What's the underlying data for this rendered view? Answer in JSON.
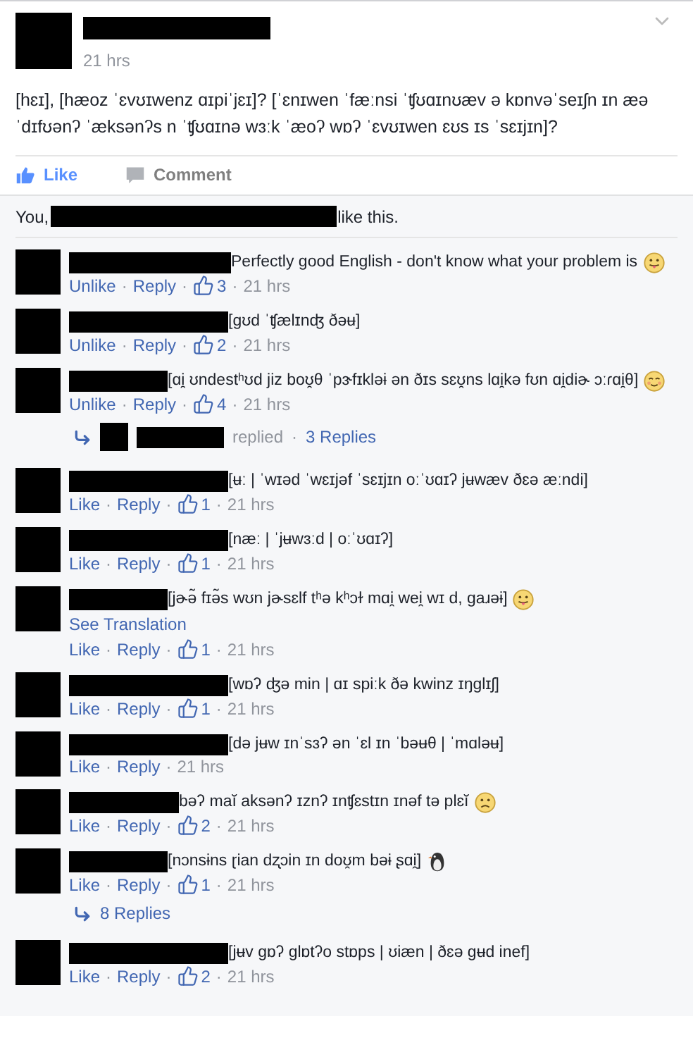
{
  "post": {
    "time": "21 hrs",
    "text": "[hɛɪ], [hæoz ˈɛvʊɪwenz ɑɪpiˈjɛɪ]? [ˈɛnɪwen ˈfæːnsi ˈʧʊɑɪnʊæv ə kɒnvəˈseɪʃn ɪn æə ˈdɪfʊənʔ ˈæksənʔs n ˈʧʊɑɪnə wɜːk ˈæoʔ wɒʔ ˈɛvʊɪwen ɛʊs ɪs ˈsɛɪjɪn]?"
  },
  "actions": [
    {
      "kind": "like",
      "label": "Like",
      "selected": true
    },
    {
      "kind": "comment",
      "label": "Comment",
      "selected": false
    }
  ],
  "likes_line": {
    "prefix": "You,",
    "suffix": "like this."
  },
  "comments": [
    {
      "text": "Perfectly good English - don't know what your problem is",
      "emoji": {
        "kind": "tongue"
      },
      "meta": [
        {
          "kind": "like",
          "text": "Unlike"
        },
        {
          "kind": "dot",
          "text": "·"
        },
        {
          "kind": "reply",
          "text": "Reply"
        },
        {
          "kind": "dot",
          "text": "·"
        },
        {
          "kind": "count",
          "text": "3"
        },
        {
          "kind": "dot",
          "text": "·"
        },
        {
          "kind": "time",
          "text": "21 hrs"
        }
      ]
    },
    {
      "text": "[gʊd ˈʧælɪnʤ ðəʉ]",
      "meta": [
        {
          "kind": "like",
          "text": "Unlike"
        },
        {
          "kind": "dot",
          "text": "·"
        },
        {
          "kind": "reply",
          "text": "Reply"
        },
        {
          "kind": "dot",
          "text": "·"
        },
        {
          "kind": "count",
          "text": "2"
        },
        {
          "kind": "dot",
          "text": "·"
        },
        {
          "kind": "time",
          "text": "21 hrs"
        }
      ]
    },
    {
      "text": "[ɑi̯ ʊndestʰʊd jiz boʊ̯θ ˈpɝfɪkləɨ ən ðɪs sɛʊ̯ns lɑi̯kə fʊn ɑi̯diɚ ɔːɾɑi̯θ]",
      "emoji": {
        "kind": "blush"
      },
      "meta": [
        {
          "kind": "like",
          "text": "Unlike"
        },
        {
          "kind": "dot",
          "text": "·"
        },
        {
          "kind": "reply",
          "text": "Reply"
        },
        {
          "kind": "dot",
          "text": "·"
        },
        {
          "kind": "count",
          "text": "4"
        },
        {
          "kind": "dot",
          "text": "·"
        },
        {
          "kind": "time",
          "text": "21 hrs"
        }
      ],
      "replies": {
        "summary": "replied",
        "sep": "·",
        "link": "3 Replies"
      }
    },
    {
      "text": "[ʉː | ˈwɪəd ˈwɛɪjəf ˈsɛɪjɪn oːˈʊɑɪʔ jʉwæv ðɛə æːndi]",
      "meta": [
        {
          "kind": "like",
          "text": "Like"
        },
        {
          "kind": "dot",
          "text": "·"
        },
        {
          "kind": "reply",
          "text": "Reply"
        },
        {
          "kind": "dot",
          "text": "·"
        },
        {
          "kind": "count",
          "text": "1"
        },
        {
          "kind": "dot",
          "text": "·"
        },
        {
          "kind": "time",
          "text": "21 hrs"
        }
      ]
    },
    {
      "text": "[næː | ˈjʉwɜːd | oːˈʊɑɪʔ]",
      "meta": [
        {
          "kind": "like",
          "text": "Like"
        },
        {
          "kind": "dot",
          "text": "·"
        },
        {
          "kind": "reply",
          "text": "Reply"
        },
        {
          "kind": "dot",
          "text": "·"
        },
        {
          "kind": "count",
          "text": "1"
        },
        {
          "kind": "dot",
          "text": "·"
        },
        {
          "kind": "time",
          "text": "21 hrs"
        }
      ]
    },
    {
      "text": "[jɚə̃ fɪə̃s wʊn jɚsɛlf tʰə kʰɔɫ mɑi̯ wei̯ wɪ d, gaɹəɨ]",
      "emoji": {
        "kind": "tongue"
      },
      "translation": "See Translation",
      "meta": [
        {
          "kind": "like",
          "text": "Like"
        },
        {
          "kind": "dot",
          "text": "·"
        },
        {
          "kind": "reply",
          "text": "Reply"
        },
        {
          "kind": "dot",
          "text": "·"
        },
        {
          "kind": "count",
          "text": "1"
        },
        {
          "kind": "dot",
          "text": "·"
        },
        {
          "kind": "time",
          "text": "21 hrs"
        }
      ]
    },
    {
      "text": "[wɒʔ ʤə min | ɑɪ spiːk ðə kwinz ɪŋglɪʃ]",
      "meta": [
        {
          "kind": "like",
          "text": "Like"
        },
        {
          "kind": "dot",
          "text": "·"
        },
        {
          "kind": "reply",
          "text": "Reply"
        },
        {
          "kind": "dot",
          "text": "·"
        },
        {
          "kind": "count",
          "text": "1"
        },
        {
          "kind": "dot",
          "text": "·"
        },
        {
          "kind": "time",
          "text": "21 hrs"
        }
      ]
    },
    {
      "text": "[də jʉw ɪnˈsɜʔ ən ˈɛl ɪn ˈbəʉθ | ˈmɑləʉ]",
      "meta": [
        {
          "kind": "like",
          "text": "Like"
        },
        {
          "kind": "dot",
          "text": "·"
        },
        {
          "kind": "reply",
          "text": "Reply"
        },
        {
          "kind": "dot",
          "text": "·"
        },
        {
          "kind": "time",
          "text": "21 hrs"
        }
      ]
    },
    {
      "text": "bəʔ maĭ aksənʔ ɪznʔ ɪnʧɛstɪn ɪnəf tə plɛĭ",
      "emoji": {
        "kind": "frown"
      },
      "meta": [
        {
          "kind": "like",
          "text": "Like"
        },
        {
          "kind": "dot",
          "text": "·"
        },
        {
          "kind": "reply",
          "text": "Reply"
        },
        {
          "kind": "dot",
          "text": "·"
        },
        {
          "kind": "count",
          "text": "2"
        },
        {
          "kind": "dot",
          "text": "·"
        },
        {
          "kind": "time",
          "text": "21 hrs"
        }
      ]
    },
    {
      "text": "[nɔnsɨns ɽian dʐɔin ɪn doʊ̯m bəɨ ʂɑi̯]",
      "emoji": {
        "kind": "penguin"
      },
      "meta": [
        {
          "kind": "like",
          "text": "Like"
        },
        {
          "kind": "dot",
          "text": "·"
        },
        {
          "kind": "reply",
          "text": "Reply"
        },
        {
          "kind": "dot",
          "text": "·"
        },
        {
          "kind": "count",
          "text": "1"
        },
        {
          "kind": "dot",
          "text": "·"
        },
        {
          "kind": "time",
          "text": "21 hrs"
        }
      ],
      "replies": {
        "link": "8 Replies"
      }
    },
    {
      "text": "[jʉv gɒʔ glɒtʔo stɒps | ʊiæn | ðɛə gʉd inef]",
      "meta": [
        {
          "kind": "like",
          "text": "Like"
        },
        {
          "kind": "dot",
          "text": "·"
        },
        {
          "kind": "reply",
          "text": "Reply"
        },
        {
          "kind": "dot",
          "text": "·"
        },
        {
          "kind": "count",
          "text": "2"
        },
        {
          "kind": "dot",
          "text": "·"
        },
        {
          "kind": "time",
          "text": "21 hrs"
        }
      ]
    }
  ]
}
